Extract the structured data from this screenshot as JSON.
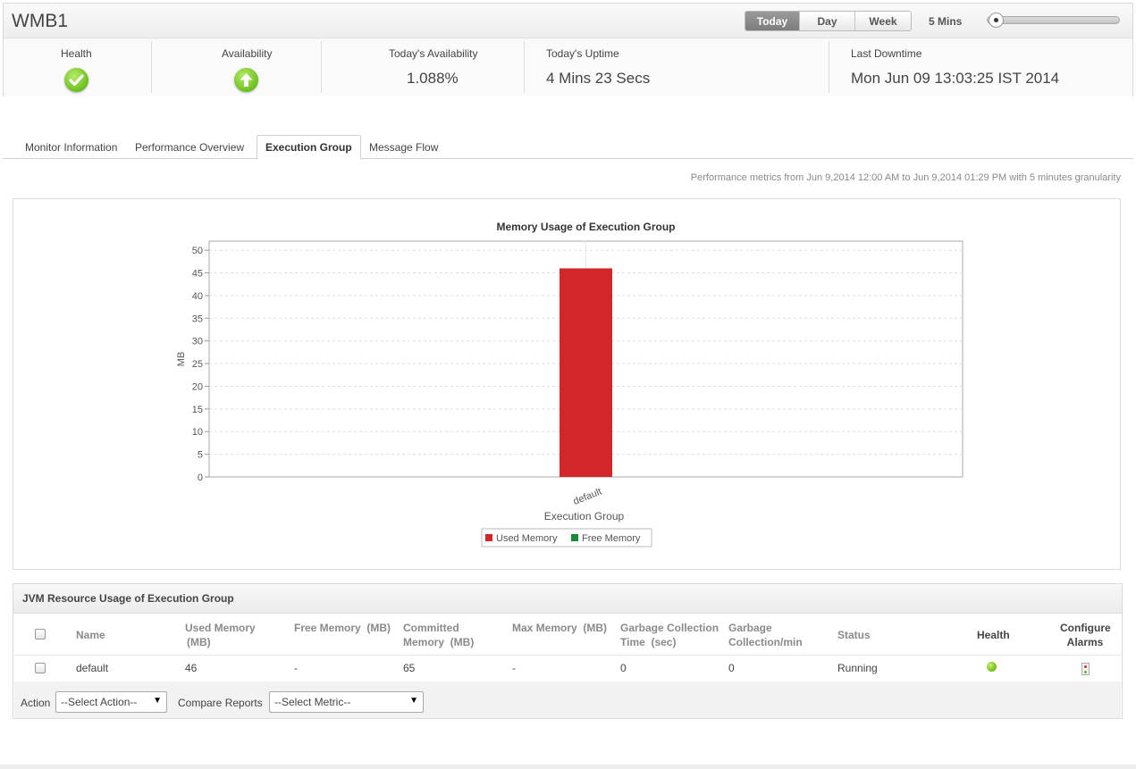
{
  "header": {
    "title": "WMB1",
    "range_buttons": [
      "Today",
      "Day",
      "Week"
    ],
    "active_range": "Today",
    "poll_interval": "5 Mins",
    "stats": {
      "health_label": "Health",
      "availability_label": "Availability",
      "todays_availability_label": "Today's Availability",
      "todays_availability_value": "1.088%",
      "todays_uptime_label": "Today's Uptime",
      "todays_uptime_value": "4 Mins 23 Secs",
      "last_downtime_label": "Last Downtime",
      "last_downtime_value": "Mon Jun 09 13:03:25 IST 2014"
    }
  },
  "tabs": [
    "Monitor Information",
    "Performance Overview",
    "Execution Group",
    "Message Flow"
  ],
  "active_tab": "Execution Group",
  "metrics_note": "Performance metrics from Jun 9,2014 12:00 AM to Jun 9,2014 01:29 PM with 5 minutes granularity",
  "chart_data": {
    "type": "bar",
    "title": "Memory Usage of Execution Group",
    "xlabel": "Execution Group",
    "ylabel": "MB",
    "categories": [
      "default"
    ],
    "series": [
      {
        "name": "Used Memory",
        "values": [
          46
        ],
        "color": "#d2262a"
      },
      {
        "name": "Free Memory",
        "values": [
          0
        ],
        "color": "#1a8a3a"
      }
    ],
    "ylim": [
      0,
      52
    ],
    "yticks": [
      0,
      5,
      10,
      15,
      20,
      25,
      30,
      35,
      40,
      45,
      50
    ],
    "stacked": true,
    "grid": true,
    "legend_position": "bottom-center"
  },
  "table": {
    "title": "JVM Resource Usage of Execution Group",
    "columns": {
      "name": "Name",
      "used_memory": [
        "Used Memory",
        "(MB)"
      ],
      "free_memory": "Free Memory  (MB)",
      "committed_memory": [
        "Committed",
        "Memory  (MB)"
      ],
      "max_memory": "Max Memory  (MB)",
      "gc_time": [
        "Garbage Collection",
        "Time  (sec)"
      ],
      "gc_rate": [
        "Garbage",
        "Collection/min"
      ],
      "status": "Status",
      "health": "Health",
      "configure_alarms": [
        "Configure",
        "Alarms"
      ]
    },
    "rows": [
      {
        "name": "default",
        "used_memory": "46",
        "free_memory": "-",
        "committed_memory": "65",
        "max_memory": "-",
        "gc_time": "0",
        "gc_rate": "0",
        "status": "Running",
        "health": "clear",
        "health_color": "#6cb514"
      }
    ],
    "action_label": "Action",
    "action_select": "--Select Action--",
    "compare_label": "Compare Reports",
    "compare_select": "--Select Metric--"
  }
}
